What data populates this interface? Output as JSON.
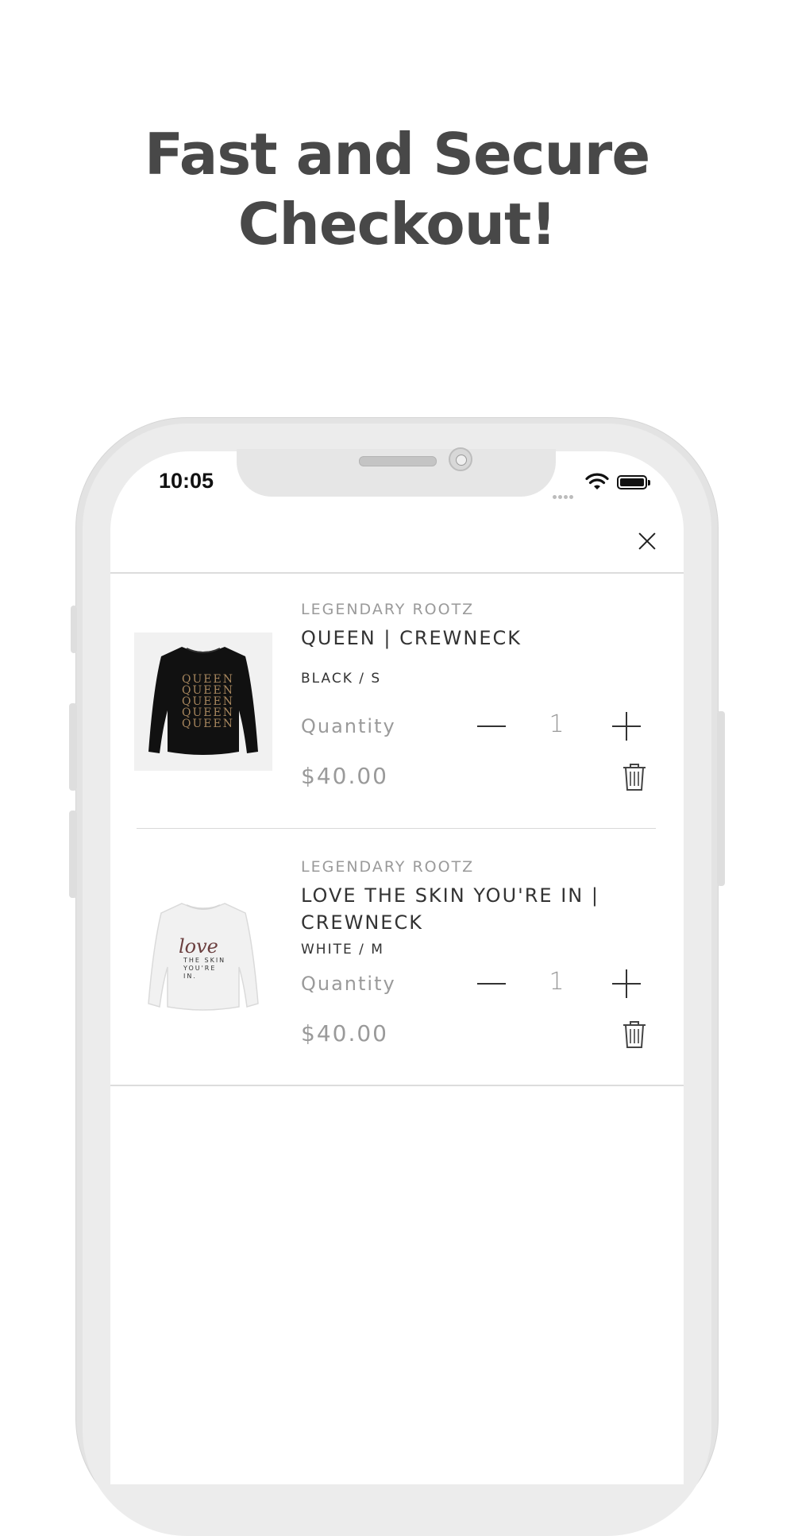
{
  "promo": {
    "headline_line1": "Fast and Secure",
    "headline_line2": "Checkout!"
  },
  "status_bar": {
    "time": "10:05"
  },
  "cart": {
    "items": [
      {
        "vendor": "LEGENDARY ROOTZ",
        "title": "QUEEN | CREWNECK",
        "variant": "BLACK / S",
        "quantity_label": "Quantity",
        "quantity": "1",
        "price": "$40.00",
        "print_text": "QUEEN"
      },
      {
        "vendor": "LEGENDARY ROOTZ",
        "title": "LOVE THE SKIN YOU'RE IN | CREWNECK",
        "variant": "WHITE / M",
        "quantity_label": "Quantity",
        "quantity": "1",
        "price": "$40.00",
        "print_script": "love",
        "print_line1": "THE SKIN",
        "print_line2": "YOU'RE",
        "print_line3": "IN."
      }
    ]
  },
  "icons": {
    "close": "close-icon",
    "minus": "minus-icon",
    "plus": "plus-icon",
    "trash": "trash-icon",
    "wifi": "wifi-icon",
    "battery": "battery-icon"
  },
  "colors": {
    "headline": "#484848",
    "muted_text": "#9a9a9a",
    "dark_text": "#333333",
    "phone_frame": "#e3e3e3"
  }
}
